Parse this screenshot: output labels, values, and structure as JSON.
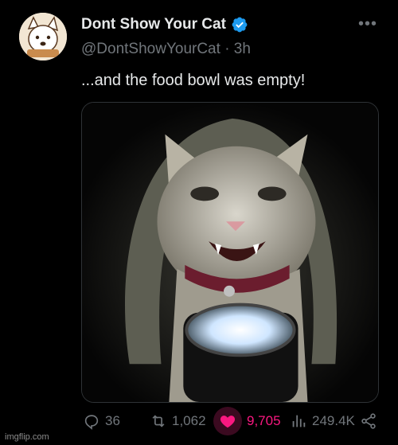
{
  "tweet": {
    "display_name": "Dont Show Your Cat",
    "handle": "@DontShowYourCat",
    "separator": "·",
    "time_ago": "3h",
    "text": "...and the food bowl was empty!",
    "verified": true
  },
  "actions": {
    "reply_count": "36",
    "retweet_count": "1,062",
    "like_count": "9,705",
    "view_count": "249.4K"
  },
  "icons": {
    "verified": "verified-badge-icon",
    "more": "more-options-icon",
    "reply": "reply-icon",
    "retweet": "retweet-icon",
    "like": "heart-icon",
    "views": "views-icon",
    "share": "share-icon"
  },
  "colors": {
    "background": "#000000",
    "like_active": "#f91880",
    "verified": "#1d9bf0",
    "secondary_text": "#71767b"
  },
  "watermark": "imgflip.com"
}
